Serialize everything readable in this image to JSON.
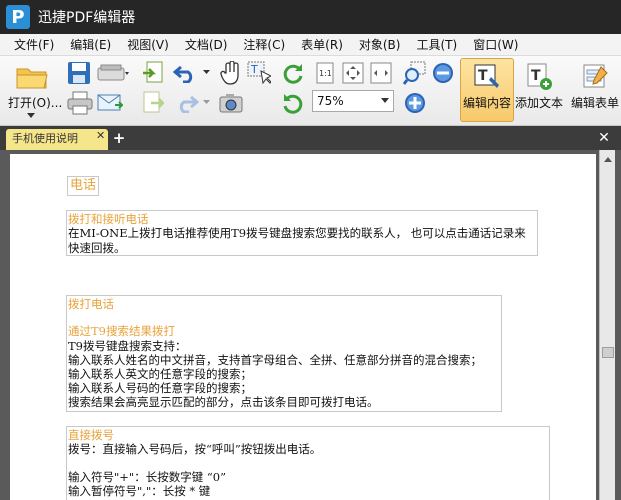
{
  "app": {
    "title": "迅捷PDF编辑器",
    "logo_letter": "P"
  },
  "menu": [
    "文件(F)",
    "编辑(E)",
    "视图(V)",
    "文档(D)",
    "注释(C)",
    "表单(R)",
    "对象(B)",
    "工具(T)",
    "窗口(W)"
  ],
  "toolbar": {
    "open_label": "打开(O)...",
    "zoom_value": "75%",
    "edit_content_label": "编辑内容",
    "add_text_label": "添加文本",
    "edit_form_label": "编辑表单"
  },
  "tabs": {
    "active_tab_label": "手机使用说明"
  },
  "document": {
    "section_heading": "电话",
    "block1": {
      "title": "拨打和接听电话",
      "line1": "在MI-ONE上拨打电话推荐使用T9拨号键盘搜索您要找的联系人，  也可以点击通话记录来",
      "line2": "快速回拨。"
    },
    "block2": {
      "title": "拨打电话",
      "subtitle": "通过T9搜索结果拨打",
      "lines": [
        "T9拨号键盘搜索支持：",
        "输入联系人姓名的中文拼音，支持首字母组合、全拼、任意部分拼音的混合搜索；",
        "输入联系人英文的任意字段的搜索；",
        "输入联系人号码的任意字段的搜索；",
        "搜索结果会高亮显示匹配的部分，点击该条目即可拨打电话。"
      ]
    },
    "block3": {
      "title": "直接拨号",
      "line1": "拨号：直接输入号码后，按“呼叫”按钮拨出电话。",
      "line2": "输入符号\"+\"：长按数字键 “0”",
      "line3": "输入暂停符号\",\"：长按 * 键"
    }
  },
  "colors": {
    "accent_orange": "#e8a23a",
    "title_bar": "#262626",
    "active_tool": "#f7c96a"
  }
}
